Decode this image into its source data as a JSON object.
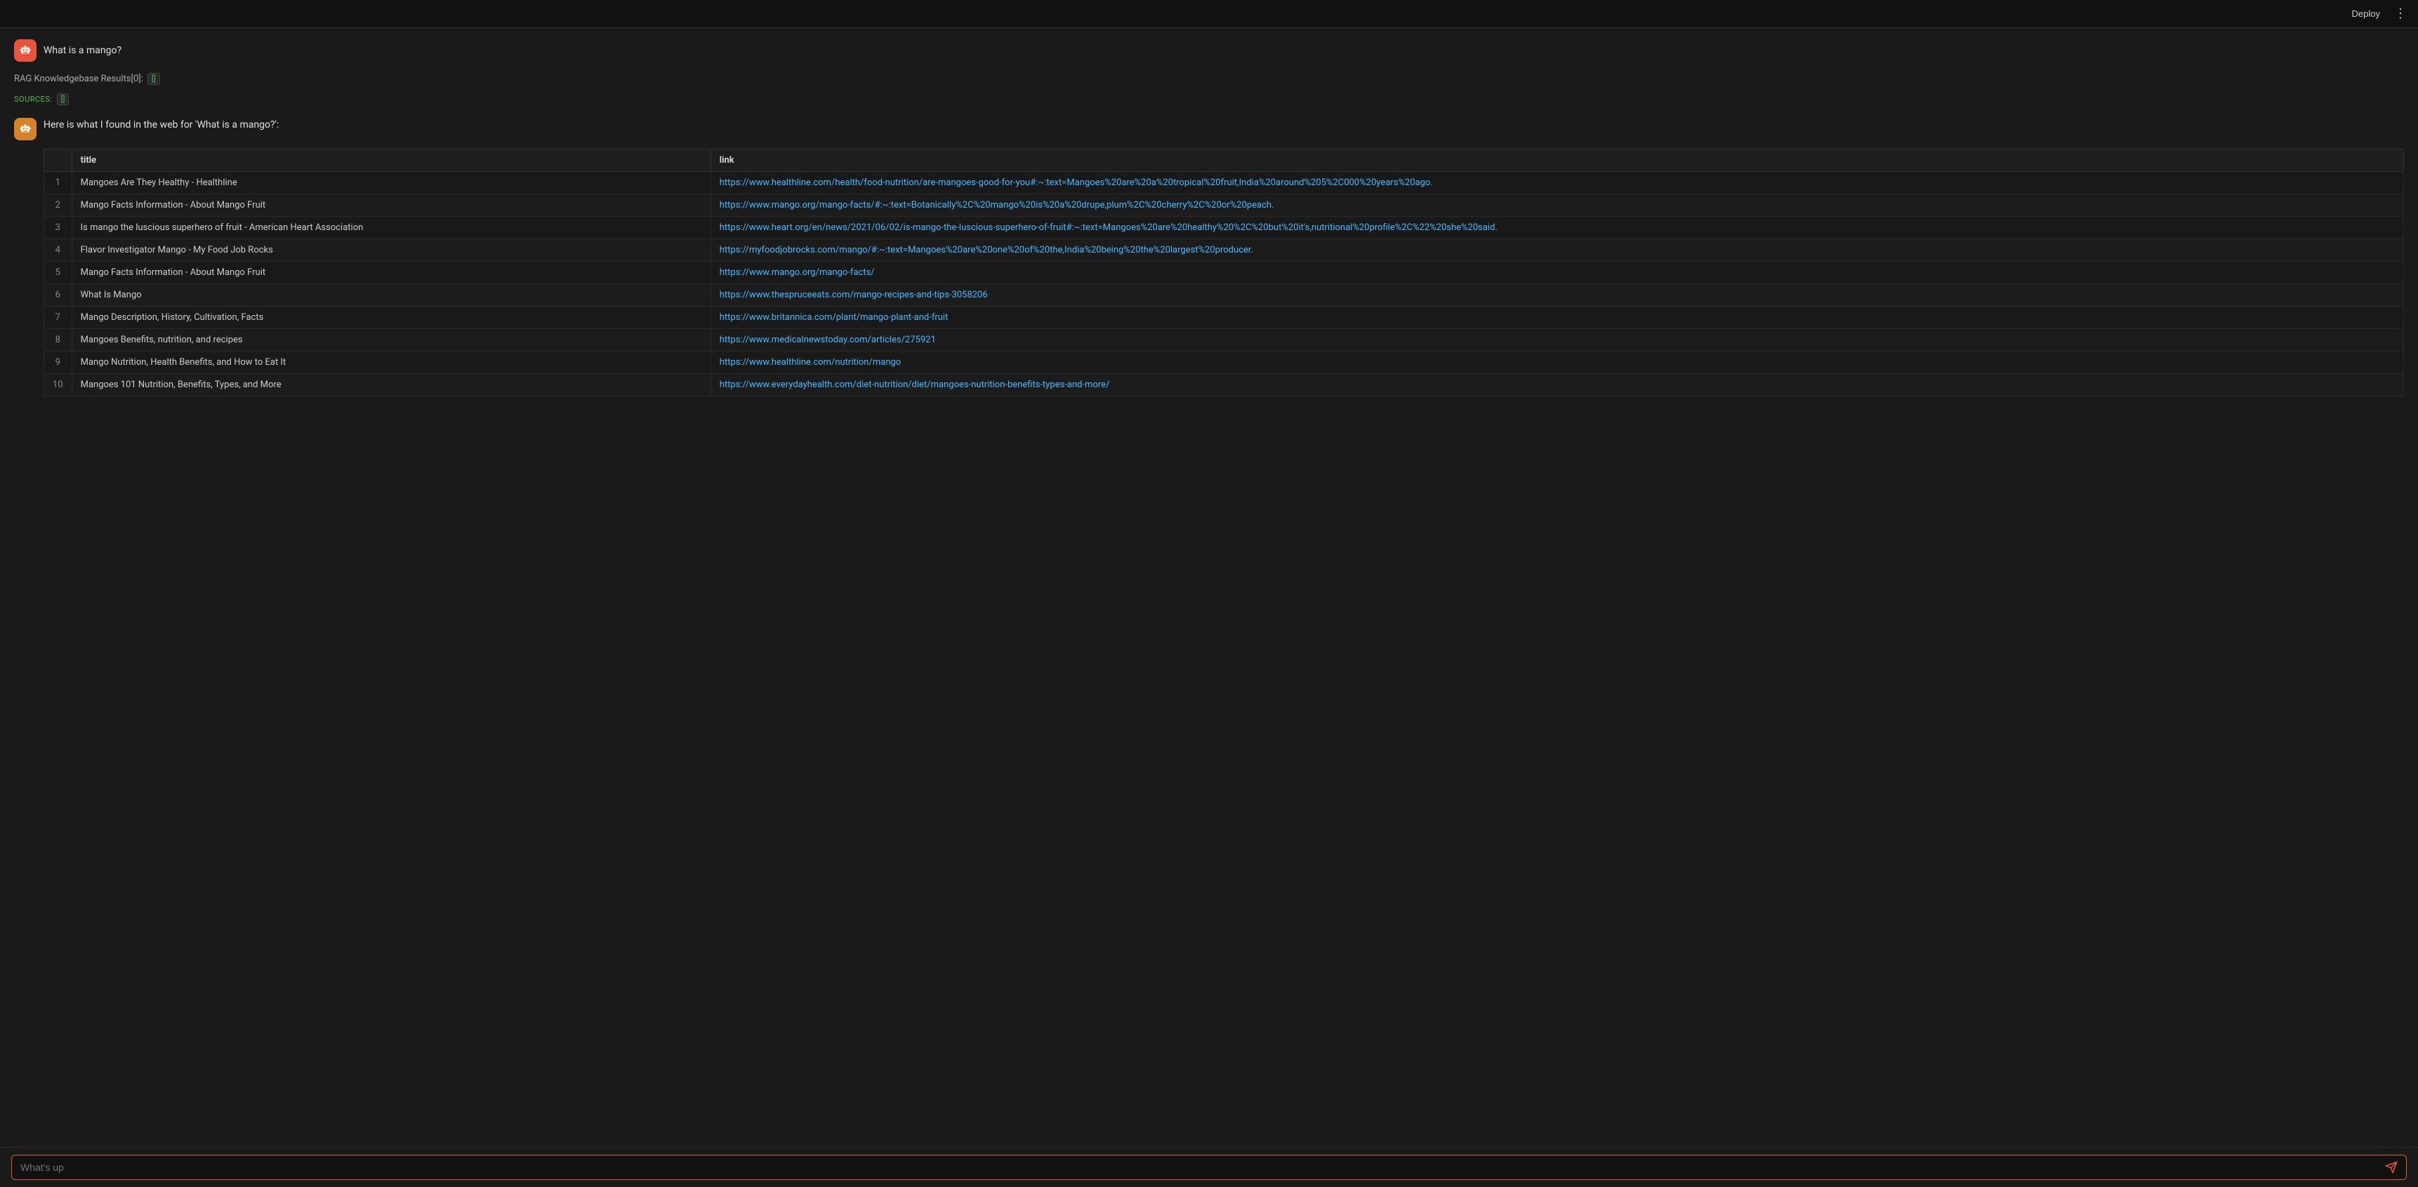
{
  "topbar": {
    "deploy_label": "Deploy",
    "more_icon": "⋮"
  },
  "user_message": {
    "text": "What is a mango?"
  },
  "rag_line": {
    "label": "RAG Knowledgebase Results[0]:",
    "badge": "[]"
  },
  "sources_line": {
    "label": "SOURCES:",
    "badge": "[]"
  },
  "bot_message": {
    "intro": "Here is what I found in the web for 'What is a mango?':"
  },
  "table": {
    "headers": {
      "empty": "",
      "title": "title",
      "link": "link"
    },
    "rows": [
      {
        "num": "1",
        "title": "Mangoes Are They Healthy - Healthline",
        "link": "https://www.healthline.com/health/food-nutrition/are-mangoes-good-for-you#:~:text=Mangoes%20are%20a%20tropical%20fruit,India%20around%205%2C000%20years%20ago.",
        "link_display": "https://www.healthline.com/health/food-nutrition/are-mangoes-good-for-you#:~:text=Mangoes%20are%20a%20tropical%20fruit,India%20around%205%2C000%20years%20ago."
      },
      {
        "num": "2",
        "title": "Mango Facts Information - About Mango Fruit",
        "link": "https://www.mango.org/mango-facts/#:~:text=Botanically%2C%20mango%20is%20a%20drupe,plum%2C%20cherry%2C%20or%20peach.",
        "link_display": "https://www.mango.org/mango-facts/#:~:text=Botanically%2C%20mango%20is%20a%20drupe,plum%2C%20cherry%2C%20or%20peach."
      },
      {
        "num": "3",
        "title": "Is mango the luscious superhero of fruit - American Heart Association",
        "link": "https://www.heart.org/en/news/2021/06/02/is-mango-the-luscious-superhero-of-fruit#:~:text=Mangoes%20are%20healthy%20%2C%20but%20it's,nutritional%20profile%2C%22%20she%20said.",
        "link_display": "https://www.heart.org/en/news/2021/06/02/is-mango-the-luscious-superhero-of-fruit#:~:text=Mangoes%20are%20healthy%20%2C%20but%20it's,nutritional%20profile%2C%22%20she%20said."
      },
      {
        "num": "4",
        "title": "Flavor Investigator Mango - My Food Job Rocks",
        "link": "https://myfoodjobrocks.com/mango/#:~:text=Mangoes%20are%20one%20of%20the,India%20being%20the%20largest%20producer.",
        "link_display": "https://myfoodjobrocks.com/mango/#:~:text=Mangoes%20are%20one%20of%20the,India%20being%20the%20largest%20producer."
      },
      {
        "num": "5",
        "title": "Mango Facts Information - About Mango Fruit",
        "link": "https://www.mango.org/mango-facts/",
        "link_display": "https://www.mango.org/mango-facts/"
      },
      {
        "num": "6",
        "title": "What Is Mango",
        "link": "https://www.thespruceeats.com/mango-recipes-and-tips-3058206",
        "link_display": "https://www.thespruceeats.com/mango-recipes-and-tips-3058206"
      },
      {
        "num": "7",
        "title": "Mango Description, History, Cultivation, Facts",
        "link": "https://www.britannica.com/plant/mango-plant-and-fruit",
        "link_display": "https://www.britannica.com/plant/mango-plant-and-fruit"
      },
      {
        "num": "8",
        "title": "Mangoes Benefits, nutrition, and recipes",
        "link": "https://www.medicalnewstoday.com/articles/275921",
        "link_display": "https://www.medicalnewstoday.com/articles/275921"
      },
      {
        "num": "9",
        "title": "Mango Nutrition, Health Benefits, and How to Eat It",
        "link": "https://www.healthline.com/nutrition/mango",
        "link_display": "https://www.healthline.com/nutrition/mango"
      },
      {
        "num": "10",
        "title": "Mangoes 101 Nutrition, Benefits, Types, and More",
        "link": "https://www.everydayhealth.com/diet-nutrition/diet/mangoes-nutrition-benefits-types-and-more/",
        "link_display": "https://www.everydayhealth.com/diet-nutrition/diet/mangoes-nutrition-benefits-types-and-more/"
      }
    ]
  },
  "input": {
    "placeholder": "What's up"
  }
}
